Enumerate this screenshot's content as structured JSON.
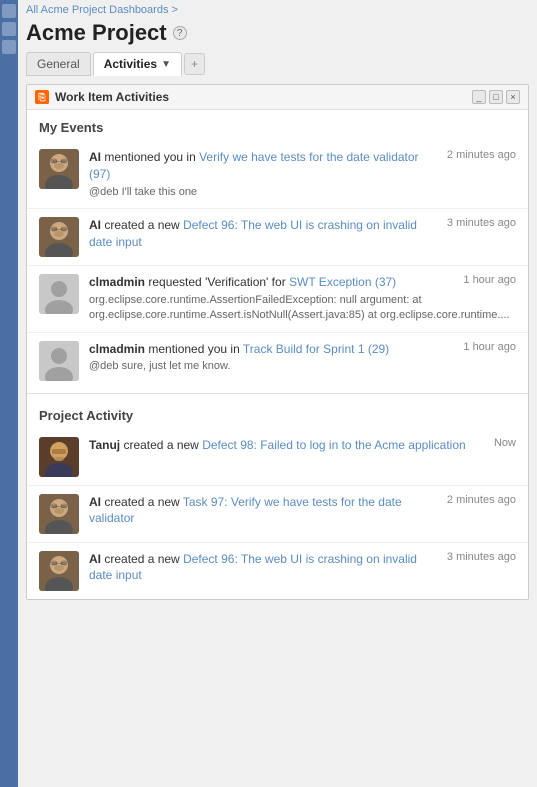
{
  "breadcrumb": {
    "link_text": "All Acme Project Dashboards",
    "arrow": ">"
  },
  "page_title": "Acme Project",
  "help_icon": "?",
  "tabs": [
    {
      "id": "general",
      "label": "General",
      "active": false
    },
    {
      "id": "activities",
      "label": "Activities",
      "active": true
    }
  ],
  "tab_add_icon": "+",
  "panel": {
    "title": "Work Item Activities",
    "rss_label": "RSS",
    "controls": [
      "_",
      "□",
      "×"
    ]
  },
  "my_events": {
    "heading": "My Events",
    "items": [
      {
        "id": "me-1",
        "time": "2 minutes ago",
        "actor": "AI",
        "action": "mentioned you in",
        "link_text": "Verify we have tests for the date validator (97)",
        "sub_text": "@deb I'll take this one",
        "avatar_type": "ai"
      },
      {
        "id": "me-2",
        "time": "3 minutes ago",
        "actor": "AI",
        "action": "created a new",
        "link_text": "Defect 96: The web UI is crashing on invalid date input",
        "sub_text": "",
        "avatar_type": "ai"
      },
      {
        "id": "me-3",
        "time": "1 hour ago",
        "actor": "clmadmin",
        "action": "requested 'Verification' for",
        "link_text": "SWT Exception (37)",
        "sub_text": "org.eclipse.core.runtime.AssertionFailedException: null argument: at org.eclipse.core.runtime.Assert.isNotNull(Assert.java:85) at org.eclipse.core.runtime....",
        "avatar_type": "generic"
      },
      {
        "id": "me-4",
        "time": "1 hour ago",
        "actor": "clmadmin",
        "action": "mentioned you in",
        "link_text": "Track Build for Sprint 1 (29)",
        "sub_text": "@deb sure, just let me know.",
        "avatar_type": "generic"
      }
    ]
  },
  "project_activity": {
    "heading": "Project Activity",
    "items": [
      {
        "id": "pa-1",
        "time": "Now",
        "actor": "Tanuj",
        "action": "created a new",
        "link_text": "Defect 98: Failed to log in to the Acme application",
        "sub_text": "",
        "avatar_type": "tanuj"
      },
      {
        "id": "pa-2",
        "time": "2 minutes ago",
        "actor": "AI",
        "action": "created a new",
        "link_text": "Task 97: Verify we have tests for the date validator",
        "sub_text": "",
        "avatar_type": "ai"
      },
      {
        "id": "pa-3",
        "time": "3 minutes ago",
        "actor": "AI",
        "action": "created a new",
        "link_text": "Defect 96: The web UI is crashing on invalid date input",
        "sub_text": "",
        "avatar_type": "ai"
      }
    ]
  }
}
